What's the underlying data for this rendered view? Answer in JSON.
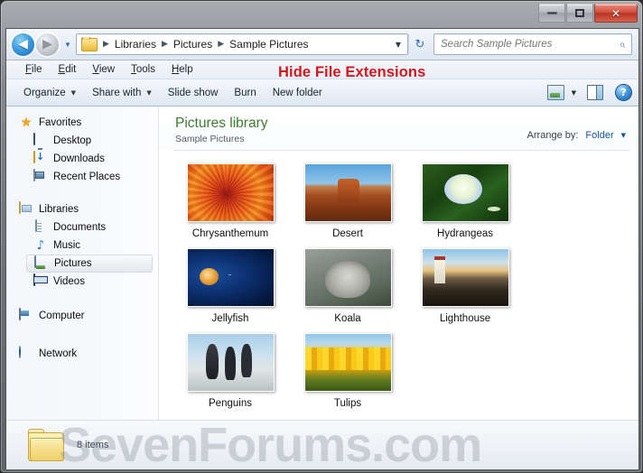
{
  "window": {
    "buttons": {
      "minimize": "minimize",
      "maximize": "maximize",
      "close": "✕"
    }
  },
  "nav": {
    "back_label": "◀",
    "forward_label": "▶",
    "recent_pages_caret": "▼",
    "breadcrumbs": [
      "Libraries",
      "Pictures",
      "Sample Pictures"
    ],
    "separator": "▶",
    "address_dropdown_caret": "▼",
    "refresh_icon": "↻",
    "search_placeholder": "Search Sample Pictures",
    "search_value": "",
    "search_icon": "⌕"
  },
  "menubar": {
    "items": [
      {
        "pre": "F",
        "rest": "ile"
      },
      {
        "pre": "E",
        "rest": "dit"
      },
      {
        "pre": "V",
        "rest": "iew"
      },
      {
        "pre": "T",
        "rest": "ools"
      },
      {
        "pre": "H",
        "rest": "elp"
      }
    ]
  },
  "toolbar": {
    "organize": "Organize",
    "share_with": "Share with",
    "slide_show": "Slide show",
    "burn": "Burn",
    "new_folder": "New folder",
    "caret": "▼",
    "help_glyph": "?"
  },
  "annotation": {
    "text": "Hide File Extensions",
    "color": "#d0191e"
  },
  "sidebar": {
    "groups": [
      {
        "header": {
          "label": "Favorites",
          "icon": "star-icon"
        },
        "items": [
          {
            "label": "Desktop",
            "icon": "desktop-icon"
          },
          {
            "label": "Downloads",
            "icon": "downloads-icon"
          },
          {
            "label": "Recent Places",
            "icon": "recent-places-icon"
          }
        ]
      },
      {
        "header": {
          "label": "Libraries",
          "icon": "libraries-icon"
        },
        "items": [
          {
            "label": "Documents",
            "icon": "documents-icon"
          },
          {
            "label": "Music",
            "icon": "music-icon"
          },
          {
            "label": "Pictures",
            "icon": "pictures-icon",
            "selected": true
          },
          {
            "label": "Videos",
            "icon": "videos-icon"
          }
        ]
      },
      {
        "header": {
          "label": "Computer",
          "icon": "computer-icon"
        },
        "items": []
      },
      {
        "header": {
          "label": "Network",
          "icon": "network-icon"
        },
        "items": []
      }
    ]
  },
  "content": {
    "library_title": "Pictures library",
    "library_subtitle": "Sample Pictures",
    "arrange_label": "Arrange by:",
    "arrange_value": "Folder",
    "arrange_caret": "▼",
    "title_color": "#3c7c2e",
    "items": [
      {
        "label": "Chrysanthemum",
        "art": "t-chrys"
      },
      {
        "label": "Desert",
        "art": "t-desert"
      },
      {
        "label": "Hydrangeas",
        "art": "t-hydr"
      },
      {
        "label": "Jellyfish",
        "art": "t-jelly"
      },
      {
        "label": "Koala",
        "art": "t-koala"
      },
      {
        "label": "Lighthouse",
        "art": "t-light"
      },
      {
        "label": "Penguins",
        "art": "t-peng"
      },
      {
        "label": "Tulips",
        "art": "t-tulip"
      }
    ]
  },
  "status": {
    "item_count": "8 items",
    "folder_icon": "folder-icon"
  },
  "watermark": {
    "text": "SevenForums.com"
  }
}
